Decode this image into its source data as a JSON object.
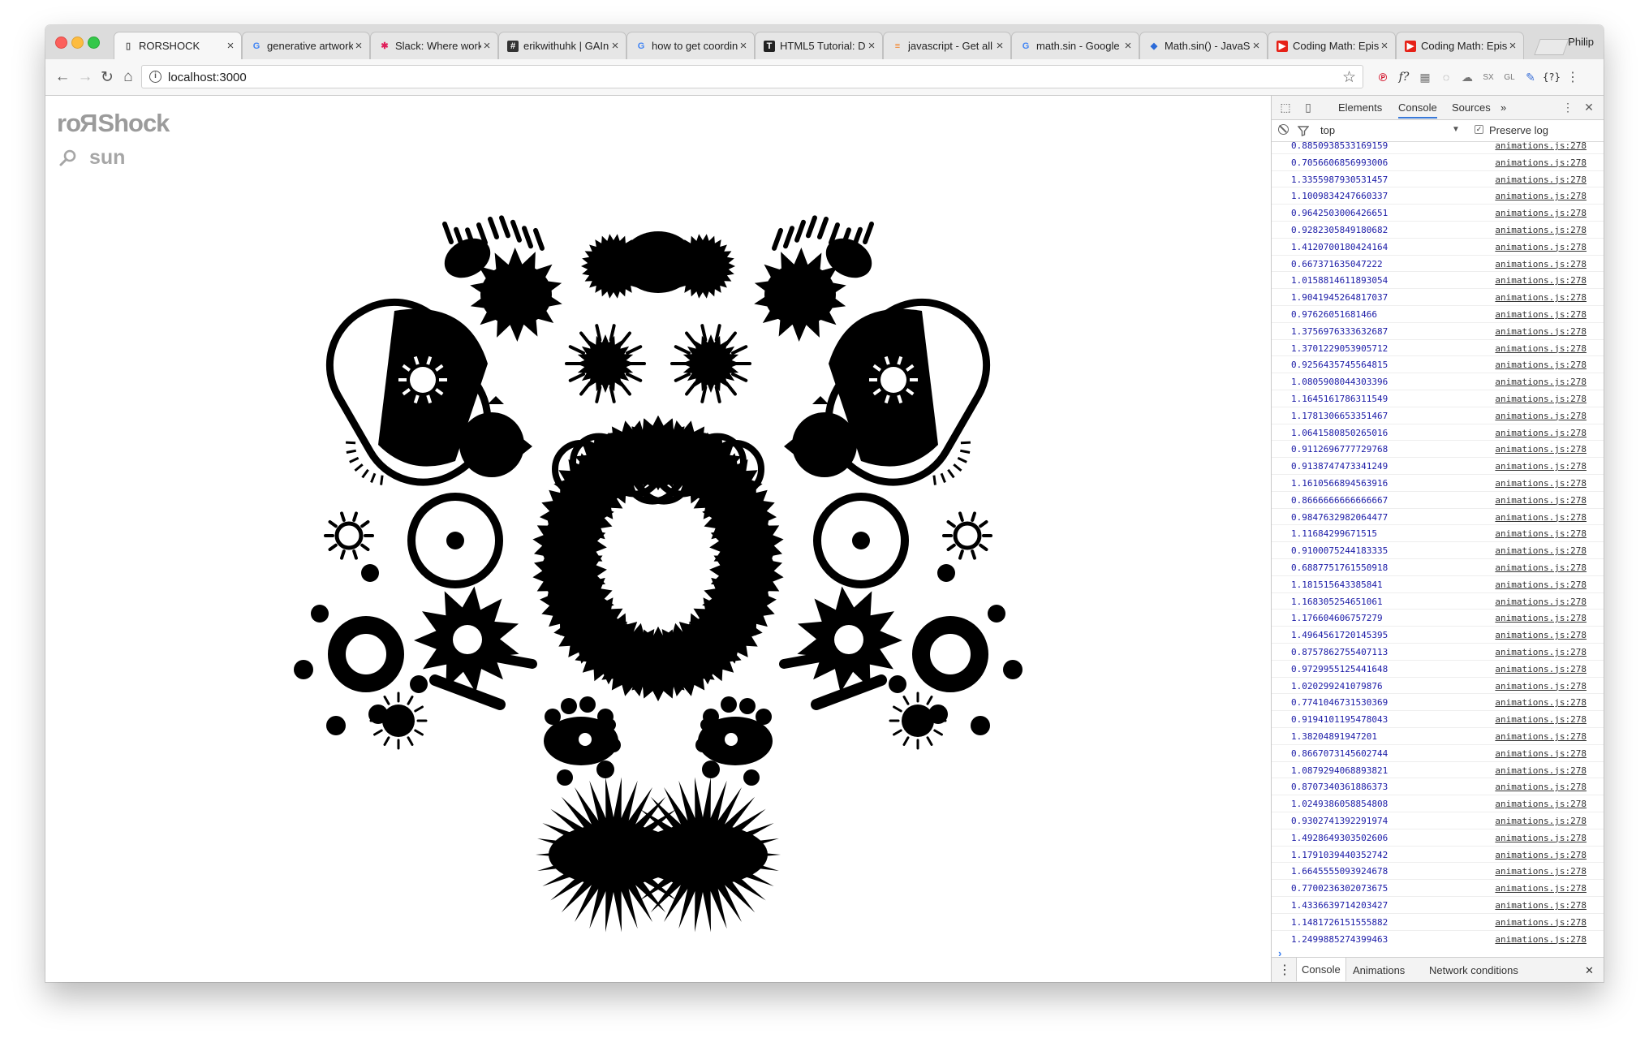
{
  "browser": {
    "tabs": [
      {
        "title": "RORSHOCK",
        "icon": "page-icon"
      },
      {
        "title": "generative artwork",
        "icon": "google-icon"
      },
      {
        "title": "Slack: Where work",
        "icon": "slack-icon"
      },
      {
        "title": "erikwithuhk | GAIn",
        "icon": "hash-icon"
      },
      {
        "title": "how to get coordin",
        "icon": "google-icon"
      },
      {
        "title": "HTML5 Tutorial: D",
        "icon": "tutorial-icon"
      },
      {
        "title": "javascript - Get all",
        "icon": "stackoverflow-icon"
      },
      {
        "title": "math.sin - Google",
        "icon": "google-icon"
      },
      {
        "title": "Math.sin() - JavaS",
        "icon": "mdn-icon"
      },
      {
        "title": "Coding Math: Epis",
        "icon": "youtube-icon"
      },
      {
        "title": "Coding Math: Epis",
        "icon": "youtube-icon"
      }
    ],
    "tab_close_glyph": "×",
    "user": "Philip",
    "url": "localhost:3000"
  },
  "page": {
    "logo_start": "ro",
    "logo_flip": "R",
    "logo_end": "Shock",
    "search_term": "sun"
  },
  "devtools": {
    "tabs": [
      "Elements",
      "Console",
      "Sources"
    ],
    "active_tab": "Console",
    "more_glyph": "»",
    "context": "top",
    "preserve_log": "Preserve log",
    "preserve_checked": true,
    "log_source": "animations.js:278",
    "log_values": [
      "0.8850938533169159",
      "0.7056606856993006",
      "1.3355987930531457",
      "1.1009834247660337",
      "0.9642503006426651",
      "0.9282305849180682",
      "1.4120700180424164",
      "0.667371635047222",
      "1.0158814611893054",
      "1.9041945264817037",
      "0.97626051681466",
      "1.3756976333632687",
      "1.3701229053905712",
      "0.9256435745564815",
      "1.0805908044303396",
      "1.1645161786311549",
      "1.1781306653351467",
      "1.0641580850265016",
      "0.9112696777729768",
      "0.9138747473341249",
      "1.1610566894563916",
      "0.8666666666666667",
      "0.9847632982064477",
      "1.11684299671515",
      "0.9100075244183335",
      "0.6887751761550918",
      "1.181515643385841",
      "1.168305254651061",
      "1.176604606757279",
      "1.4964561720145395",
      "0.8757862755407113",
      "0.9729955125441648",
      "1.020299241079876",
      "0.7741046731530369",
      "0.9194101195478043",
      "1.38204891947201",
      "0.8667073145602744",
      "1.0879294068893821",
      "0.8707340361886373",
      "1.0249386058854808",
      "0.9302741392291974",
      "1.4928649303502606",
      "1.1791039440352742",
      "1.6645555093924678",
      "0.7700236302073675",
      "1.4336639714203427",
      "1.1481726151555882",
      "1.2499885274399463"
    ],
    "drawer_tabs": [
      "Console",
      "Animations",
      "Network conditions"
    ]
  },
  "colors": {
    "art": "#000000",
    "logo": "#9b9b9b",
    "log_value": "#1a1aa6",
    "accent": "#3879d9"
  }
}
